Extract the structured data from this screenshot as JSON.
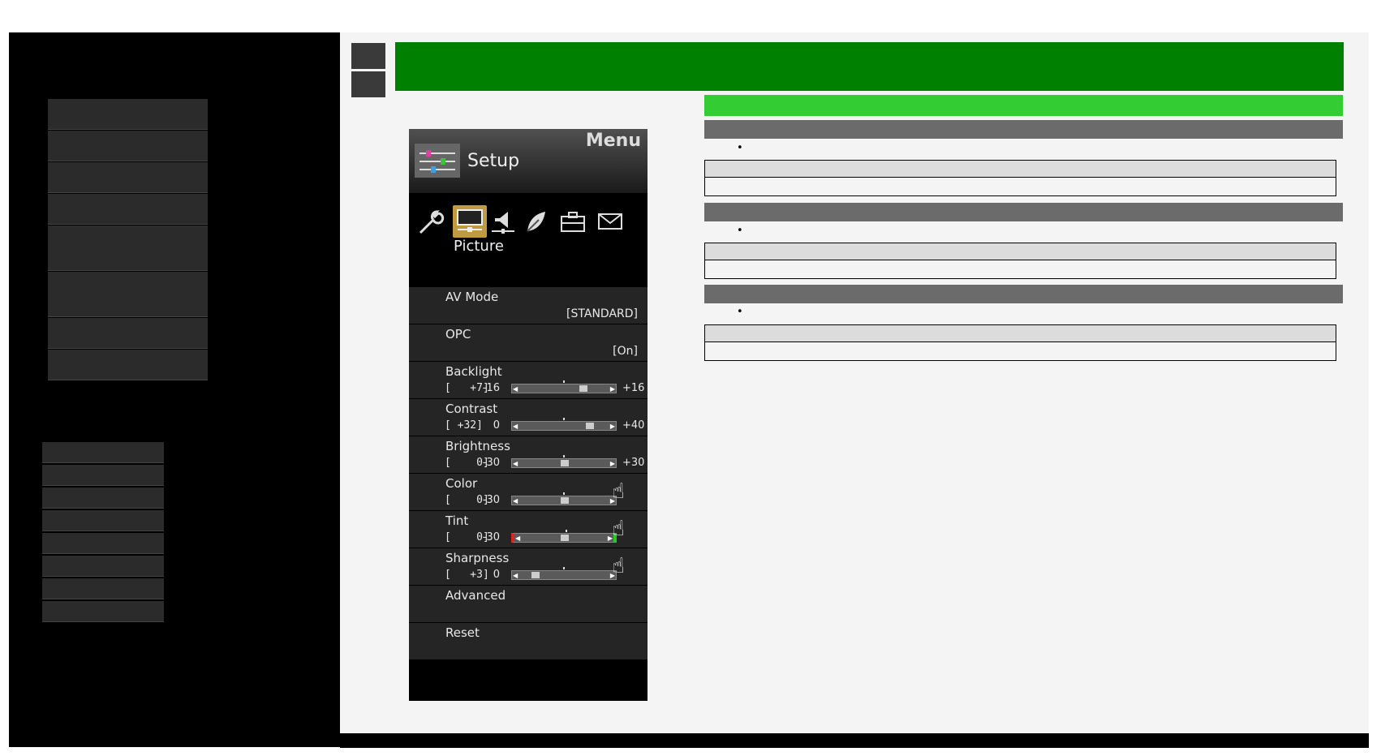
{
  "tv_menu": {
    "header": "Menu",
    "section": "Setup",
    "category": "Picture",
    "tabs": [
      "wrench-icon",
      "picture-icon",
      "speaker-icon",
      "leaf-icon",
      "toolbox-icon",
      "envelope-icon"
    ],
    "rows": [
      {
        "label": "AV Mode",
        "value": "[STANDARD]"
      },
      {
        "label": "OPC",
        "value": "[On]"
      },
      {
        "label": "Backlight",
        "current": "[   +7]",
        "min": "-16",
        "max": "+16",
        "level": 0.72
      },
      {
        "label": "Contrast",
        "current": "[ +32]",
        "min": "0",
        "max": "+40",
        "level": 0.8
      },
      {
        "label": "Brightness",
        "current": "[    0]",
        "min": "-30",
        "max": "+30",
        "level": 0.5
      },
      {
        "label": "Color",
        "current": "[    0]",
        "min": "-30",
        "max": "",
        "level": 0.5
      },
      {
        "label": "Tint",
        "current": "[    0]",
        "min": "-30",
        "max": "",
        "level": 0.5
      },
      {
        "label": "Sharpness",
        "current": "[   +3]",
        "min": "0",
        "max": "",
        "level": 0.15
      },
      {
        "label": "Advanced"
      },
      {
        "label": "Reset"
      }
    ]
  },
  "bullets": [
    "•",
    "•",
    "•"
  ],
  "colors": {
    "title_bar": "#008000",
    "sub_bar": "#33cc33",
    "gray_bar": "#6b6b6b",
    "sidebar": "#000000",
    "tint_left": "#dd2222",
    "tint_right": "#22cc22"
  }
}
